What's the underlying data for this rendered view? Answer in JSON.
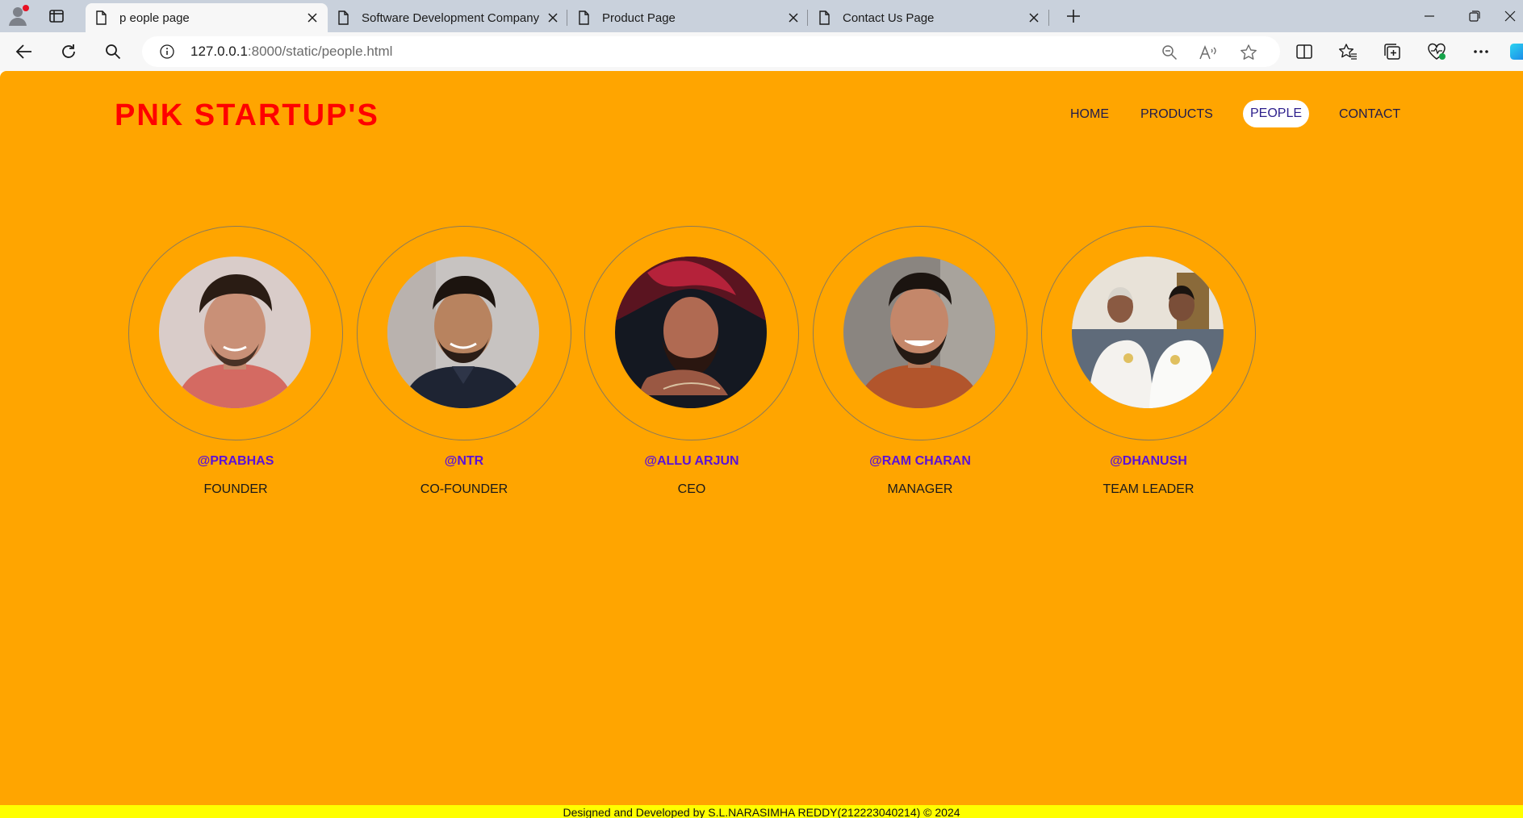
{
  "browser": {
    "tabs": [
      {
        "title": "p eople page",
        "active": true
      },
      {
        "title": "Software Development Company",
        "active": false
      },
      {
        "title": "Product Page",
        "active": false
      },
      {
        "title": "Contact Us Page",
        "active": false
      }
    ],
    "address": {
      "host": "127.0.0.1",
      "rest": ":8000/static/people.html"
    },
    "icons": {
      "profile": "profile-icon",
      "workspaces": "workspaces-icon",
      "back": "back-arrow-icon",
      "refresh": "refresh-icon",
      "search": "search-icon",
      "info": "info-icon",
      "zoom_out": "zoom-out-icon",
      "read_aloud": "read-aloud-icon",
      "favorite": "star-icon",
      "split": "split-screen-icon",
      "favorites": "favorites-icon",
      "collections": "collections-icon",
      "performance": "heartbeat-icon",
      "more": "more-icon",
      "copilot": "copilot-icon"
    }
  },
  "page": {
    "brand": "PNK STARTUP'S",
    "background_color": "#ffa500",
    "brand_color": "#ff0000",
    "nav": [
      {
        "label": "HOME",
        "active": false
      },
      {
        "label": "PRODUCTS",
        "active": false
      },
      {
        "label": "PEOPLE",
        "active": true
      },
      {
        "label": "CONTACT",
        "active": false
      }
    ],
    "people": [
      {
        "handle": "@PRABHAS",
        "role": "FOUNDER"
      },
      {
        "handle": "@NTR",
        "role": "CO-FOUNDER"
      },
      {
        "handle": "@ALLU ARJUN",
        "role": "CEO"
      },
      {
        "handle": "@RAM CHARAN",
        "role": "MANAGER"
      },
      {
        "handle": "@DHANUSH",
        "role": "TEAM LEADER"
      }
    ],
    "footer": "Designed and Developed by S.L.NARASIMHA REDDY(212223040214) © 2024",
    "footer_color": "#ffff00"
  }
}
